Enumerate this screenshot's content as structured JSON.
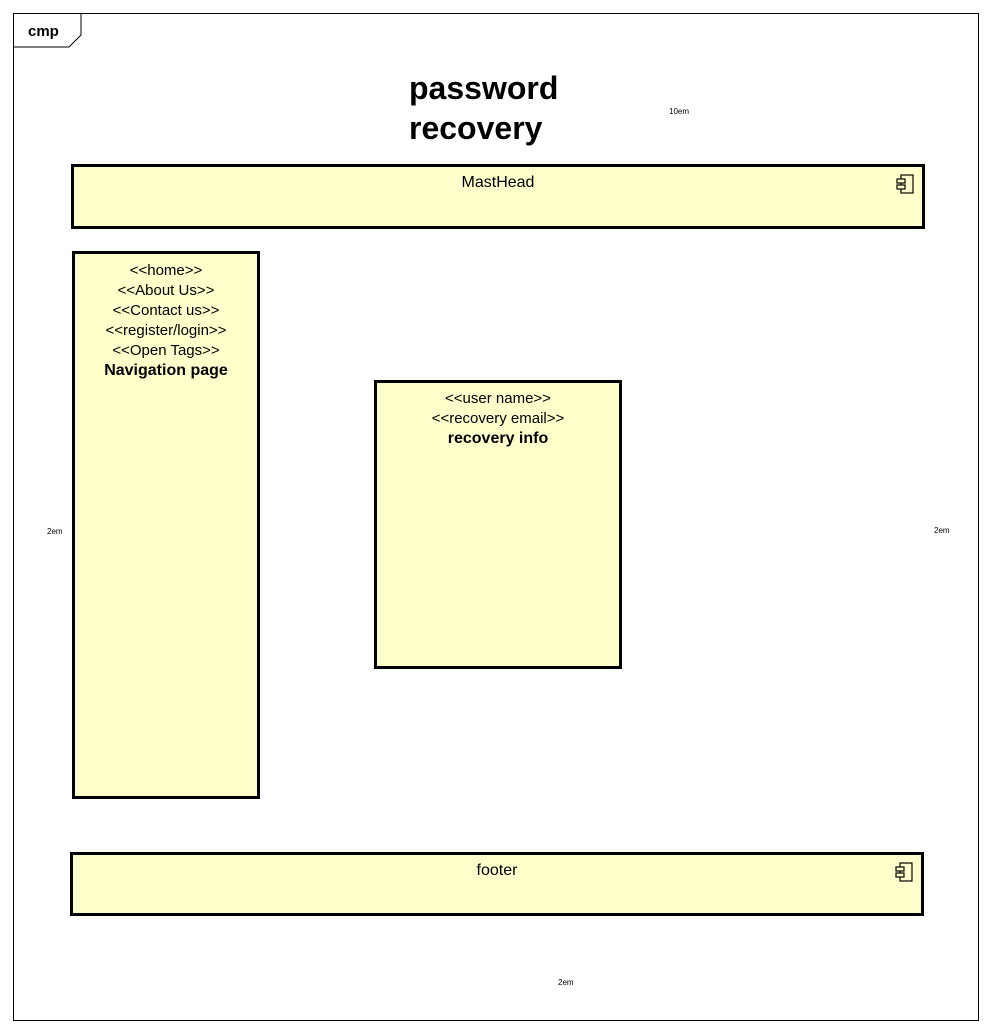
{
  "frame": {
    "tab_label": "cmp"
  },
  "title": {
    "line1": "password",
    "line2": "recovery"
  },
  "notes": {
    "top": "10em",
    "left": "2em",
    "right": "2em",
    "bottom": "2em"
  },
  "masthead": {
    "name": "MastHead",
    "icon": "component-icon"
  },
  "navigation": {
    "items": [
      "<<home>>",
      "<<About Us>>",
      "<<Contact us>>",
      "<<register/login>>",
      "<<Open Tags>>"
    ],
    "name": "Navigation page"
  },
  "recovery": {
    "items": [
      "<<user name>>",
      "<<recovery email>>"
    ],
    "name": "recovery info"
  },
  "footer": {
    "name": "footer",
    "icon": "component-icon"
  },
  "colors": {
    "box_fill": "#ffffcc",
    "stroke": "#000000"
  }
}
